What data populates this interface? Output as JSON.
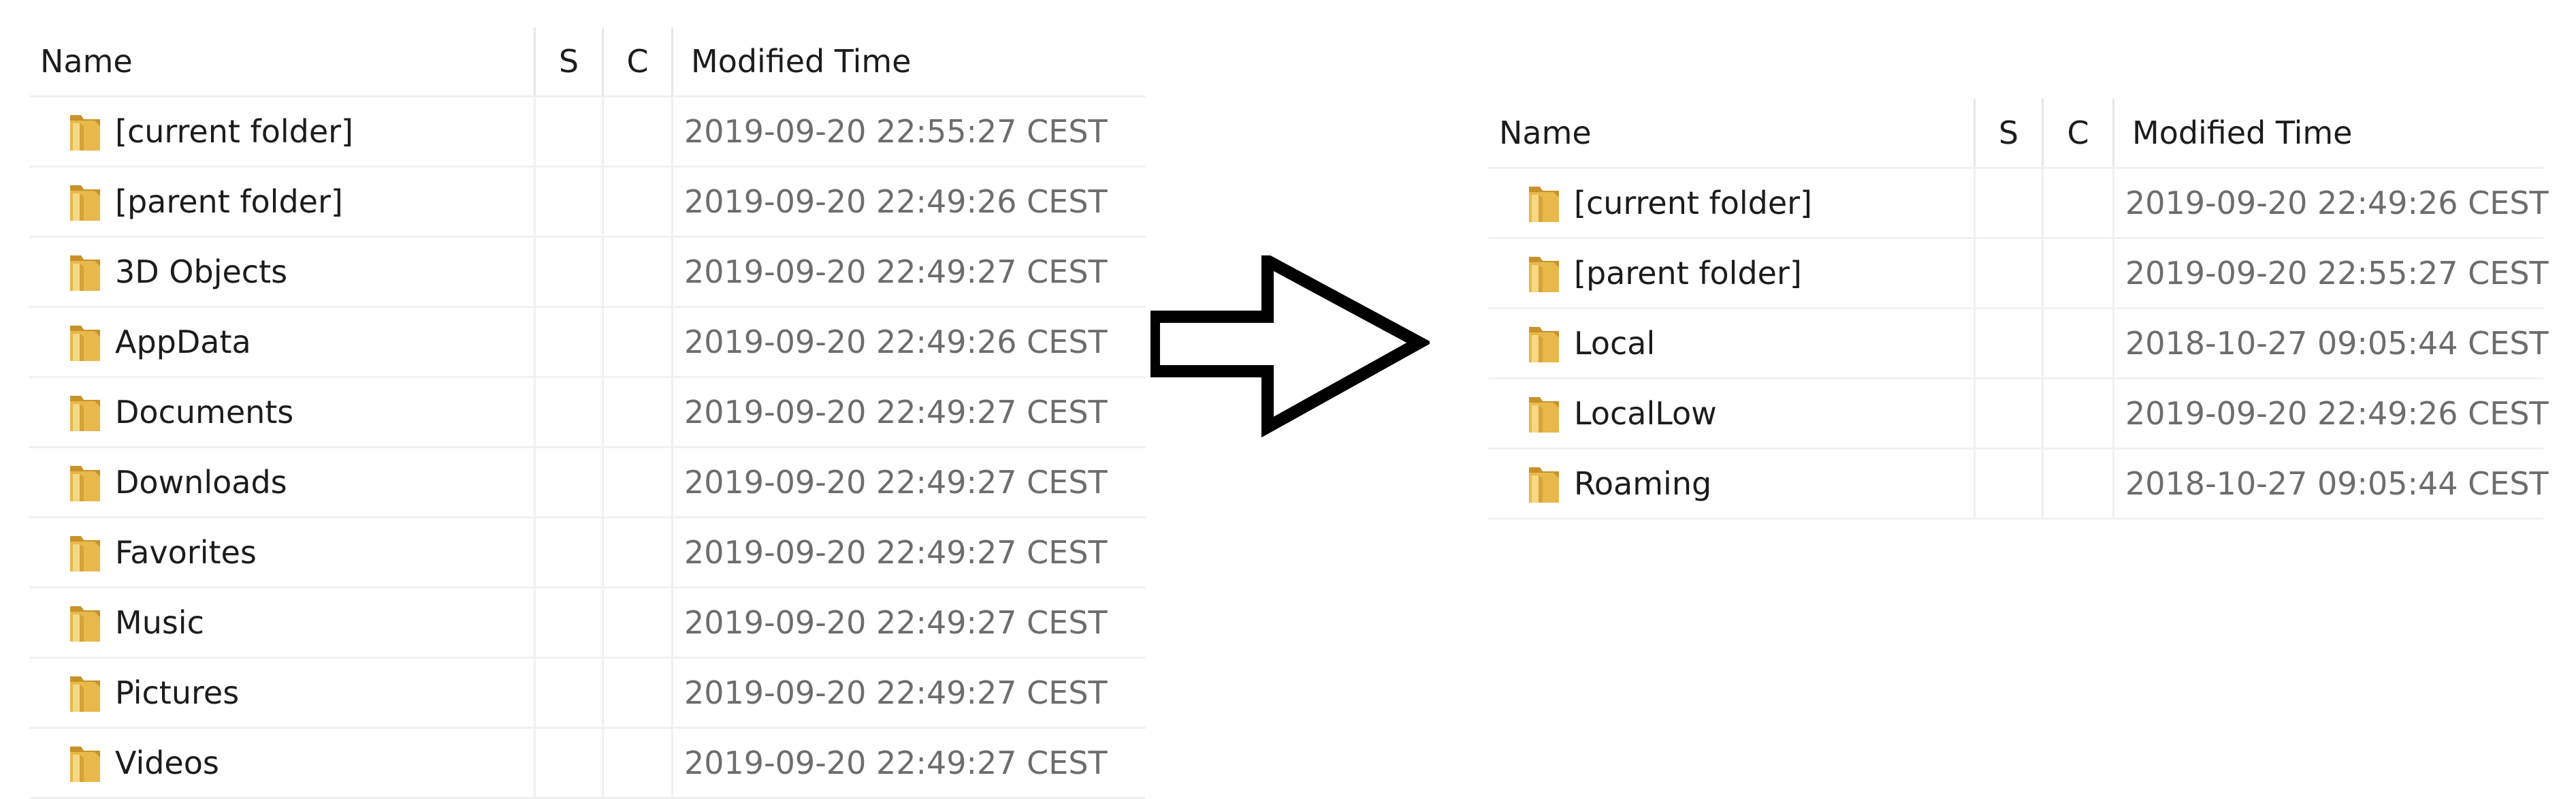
{
  "columns": {
    "name": "Name",
    "s": "S",
    "c": "C",
    "modified": "Modified Time"
  },
  "left_list": [
    {
      "name": "[current folder]",
      "modified": "2019-09-20 22:55:27 CEST"
    },
    {
      "name": "[parent folder]",
      "modified": "2019-09-20 22:49:26 CEST"
    },
    {
      "name": "3D Objects",
      "modified": "2019-09-20 22:49:27 CEST"
    },
    {
      "name": "AppData",
      "modified": "2019-09-20 22:49:26 CEST"
    },
    {
      "name": "Documents",
      "modified": "2019-09-20 22:49:27 CEST"
    },
    {
      "name": "Downloads",
      "modified": "2019-09-20 22:49:27 CEST"
    },
    {
      "name": "Favorites",
      "modified": "2019-09-20 22:49:27 CEST"
    },
    {
      "name": "Music",
      "modified": "2019-09-20 22:49:27 CEST"
    },
    {
      "name": "Pictures",
      "modified": "2019-09-20 22:49:27 CEST"
    },
    {
      "name": "Videos",
      "modified": "2019-09-20 22:49:27 CEST"
    }
  ],
  "right_list": [
    {
      "name": "[current folder]",
      "modified": "2019-09-20 22:49:26 CEST"
    },
    {
      "name": "[parent folder]",
      "modified": "2019-09-20 22:55:27 CEST"
    },
    {
      "name": "Local",
      "modified": "2018-10-27 09:05:44 CEST"
    },
    {
      "name": "LocalLow",
      "modified": "2019-09-20 22:49:26 CEST"
    },
    {
      "name": "Roaming",
      "modified": "2018-10-27 09:05:44 CEST"
    }
  ],
  "icons": {
    "row": "folder-icon",
    "transition": "right-arrow-icon"
  },
  "colors": {
    "folder": "#e8b84a",
    "folder_dark": "#c8922a",
    "time_text": "#6d6d6d",
    "text": "#1c1c1c"
  }
}
